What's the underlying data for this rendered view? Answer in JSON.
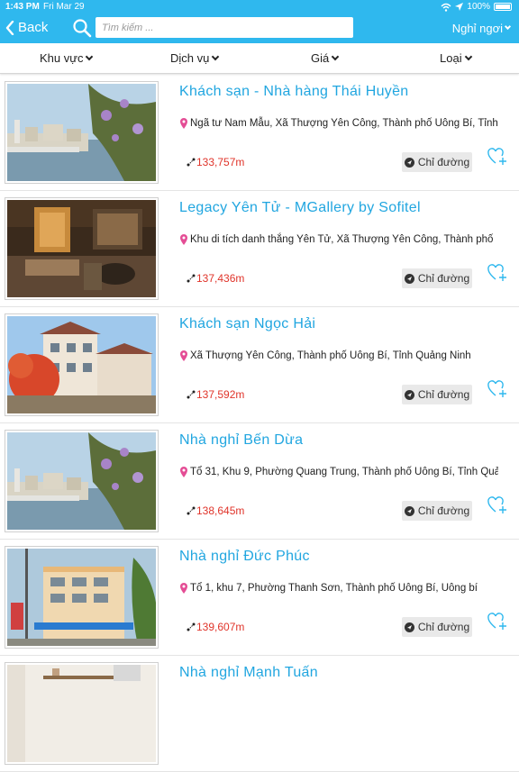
{
  "status": {
    "time": "1:43 PM",
    "date": "Fri Mar 29",
    "battery": "100%"
  },
  "nav": {
    "back_label": "Back",
    "search_placeholder": "Tìm kiếm ...",
    "type_label": "Nghỉ ngơi"
  },
  "filters": [
    {
      "label": "Khu vực"
    },
    {
      "label": "Dịch vụ"
    },
    {
      "label": "Giá"
    },
    {
      "label": "Loại"
    }
  ],
  "directions_label": "Chỉ đường",
  "items": [
    {
      "title": "Khách sạn - Nhà hàng Thái Huyền",
      "address": "Ngã tư Nam Mẫu, Xã Thượng Yên Công, Thành phố Uông Bí, Tỉnh",
      "distance": "133,757m"
    },
    {
      "title": "Legacy Yên Tử - MGallery by Sofitel",
      "address": "Khu di tích danh thắng Yên Tử, Xã Thượng Yên Công, Thành phố",
      "distance": "137,436m"
    },
    {
      "title": "Khách sạn Ngọc Hải",
      "address": "Xã Thượng Yên Công, Thành phố Uông Bí, Tỉnh Quảng Ninh",
      "distance": "137,592m"
    },
    {
      "title": "Nhà nghỉ Bến Dừa",
      "address": "Tổ 31, Khu 9, Phường Quang Trung, Thành phố Uông Bí, Tỉnh Quả",
      "distance": "138,645m"
    },
    {
      "title": "Nhà nghỉ Đức Phúc",
      "address": "Tổ 1, khu 7, Phường Thanh Sơn, Thành phố Uông Bí, Uông bí",
      "distance": "139,607m"
    },
    {
      "title": "Nhà nghỉ Mạnh Tuấn",
      "address": "",
      "distance": ""
    }
  ]
}
